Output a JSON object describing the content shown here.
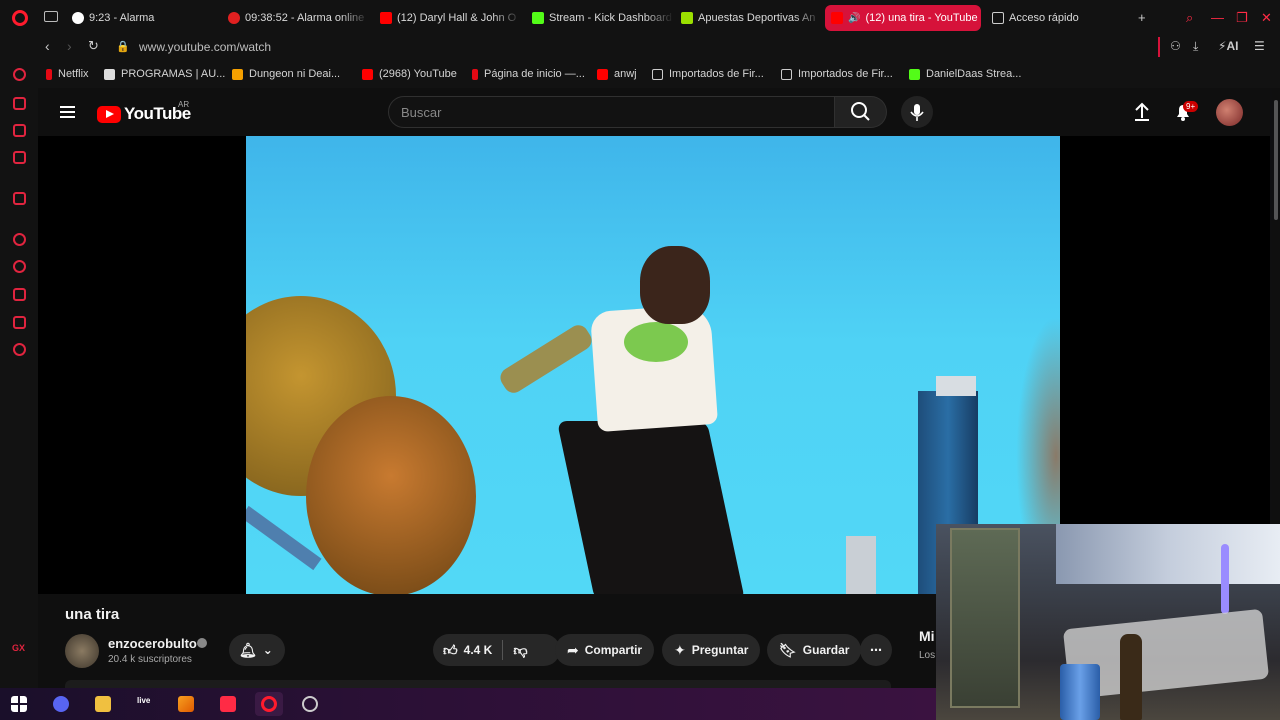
{
  "browser": {
    "tabs": [
      {
        "label": "9:23 - Alarma",
        "color": "#ffffff"
      },
      {
        "label": "09:38:52 - Alarma online",
        "color": "#e02020"
      },
      {
        "label": "(12) Daryl Hall & John O",
        "color": "#ff0000"
      },
      {
        "label": "Stream - Kick Dashboard",
        "color": "#53fc18"
      },
      {
        "label": "Apuestas Deportivas An",
        "color": "#9be000"
      },
      {
        "label": "(12) una tira - YouTube",
        "color": "#ff0000",
        "active": true
      },
      {
        "label": "Acceso rápido",
        "color": "#cccccc"
      }
    ],
    "url": "www.youtube.com/watch",
    "ai_label": "AI",
    "bookmarks": [
      {
        "label": "Netflix",
        "color": "#e50914"
      },
      {
        "label": "PROGRAMAS | AU...",
        "color": "#dddddd"
      },
      {
        "label": "Dungeon ni Deai...",
        "color": "#f5a000"
      },
      {
        "label": "(2968) YouTube",
        "color": "#ff0000"
      },
      {
        "label": "Página de inicio —...",
        "color": "#e50914"
      },
      {
        "label": "anwj",
        "color": "#ff0000"
      },
      {
        "label": "Importados de Fir...",
        "color": "#cccccc"
      },
      {
        "label": "Importados de Fir...",
        "color": "#cccccc"
      },
      {
        "label": "DanielDaas Strea...",
        "color": "#53fc18"
      }
    ],
    "sidebar_label": "GX"
  },
  "youtube": {
    "logo_text": "YouTube",
    "country_code": "AR",
    "search_placeholder": "Buscar",
    "notification_badge": "9+",
    "video": {
      "title": "una tira",
      "channel": "enzocerobulto",
      "subscribers": "20.4 k suscriptores",
      "likes": "4.4 K",
      "share_label": "Compartir",
      "ask_label": "Preguntar",
      "save_label": "Guardar",
      "side_text_1": "Mi",
      "side_text_2": "Los"
    }
  },
  "taskbar": {
    "live_label": "live"
  },
  "colors": {
    "opera_red": "#ff1b2d",
    "active_tab": "#d6123a",
    "youtube_red": "#ff0000"
  }
}
